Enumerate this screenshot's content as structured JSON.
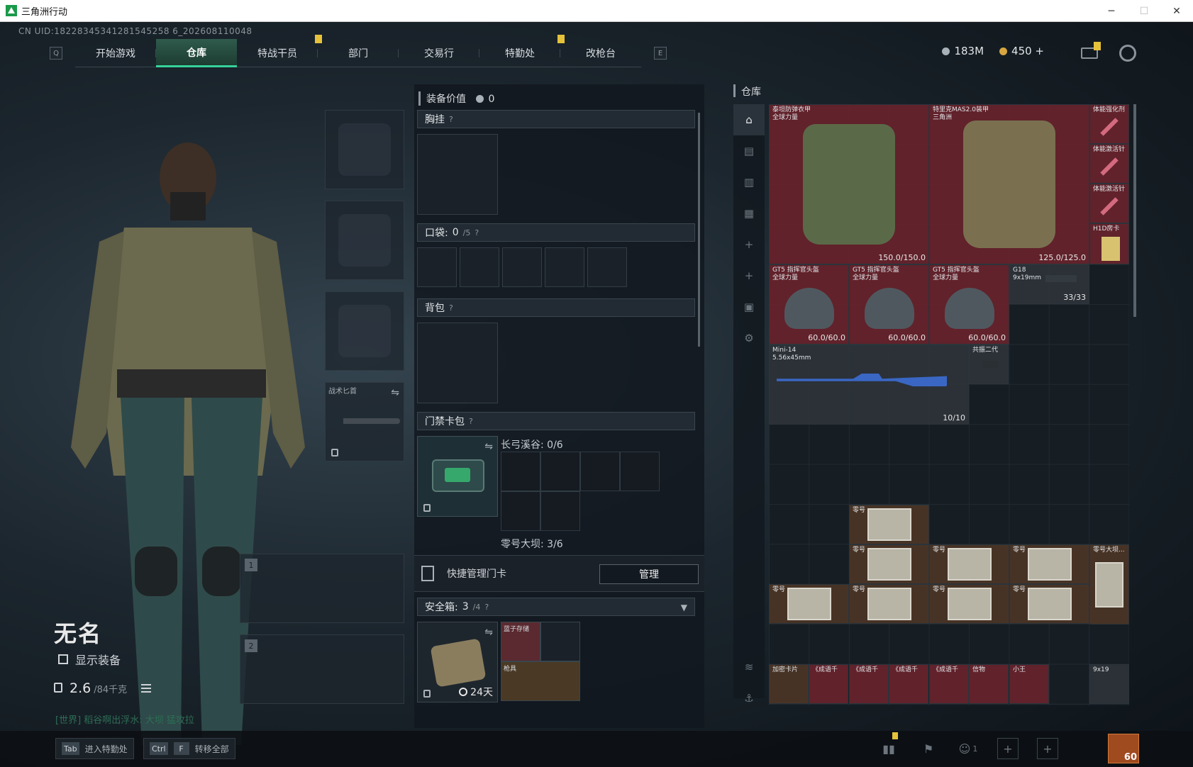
{
  "window": {
    "title": "三角洲行动",
    "minimize": "─",
    "maximize": "☐",
    "close": "✕"
  },
  "uid": "CN UID:18228345341281545258 6_202608110048",
  "nav": {
    "left_key": "Q",
    "right_key": "E",
    "tabs": [
      {
        "label": "开始游戏",
        "active": false
      },
      {
        "label": "仓库",
        "active": true
      },
      {
        "label": "特战干员",
        "active": false
      },
      {
        "label": "部门",
        "active": false
      },
      {
        "label": "交易行",
        "active": false
      },
      {
        "label": "特勤处",
        "active": false
      },
      {
        "label": "改枪台",
        "active": false
      }
    ]
  },
  "currency": {
    "silver": "183M",
    "gold": "450 +"
  },
  "character": {
    "name": "无名",
    "show_equipment": "显示装备",
    "weight": "2.6",
    "weight_max": "/84千克",
    "world_chat": "[世界] 稻谷啊出浮水: 大坝 猛攻拉"
  },
  "gear_slots": {
    "melee_label": "战术匕首",
    "weapon1": "1",
    "weapon2": "2"
  },
  "equipment": {
    "value_label": "装备价值",
    "value": "0",
    "chest_rig": "胸挂",
    "pocket": "口袋:",
    "pocket_count": "0",
    "pocket_max": "/5",
    "backpack": "背包",
    "access_card": "门禁卡包",
    "map1": "长弓溪谷: 0/6",
    "map2": "零号大坝: 3/6",
    "quick_manage": "快捷管理门卡",
    "manage": "管理",
    "safebox": "安全箱:",
    "safebox_count": "3",
    "safebox_max": "/4",
    "safebox_timer": "24天",
    "safebox_items": [
      "蓝子存储",
      "枪具"
    ],
    "help": "?"
  },
  "warehouse": {
    "title": "仓库",
    "items": {
      "armor1_name": "泰坦防弹衣甲\n全球力量",
      "armor1_dur": "150.0/150.0",
      "armor2_name": "特里克MAS2.0装甲\n三角洲",
      "armor2_dur": "125.0/125.0",
      "syringe1": "体能强化剂",
      "syringe2": "体能激活针",
      "syringe3": "体能激活针",
      "card": "H1D房卡",
      "helmet_name": "GT5 指挥官头盔\n全球力量",
      "helmet_dur": "60.0/60.0",
      "pistol_name": "G18\n9x19mm",
      "pistol_ammo": "33/33",
      "rifle_name": "Mini-14\n5.56x45mm",
      "rifle_ammo": "10/10",
      "scope_name": "共振二代",
      "map_name": "零号",
      "map_big": "零号大坝...",
      "bottom": [
        "加密卡片",
        "《成语千",
        "《成语千",
        "《成语千",
        "《成语千",
        "信物",
        "小王",
        "9x19"
      ]
    }
  },
  "bottom_bar": {
    "tab_key": "Tab",
    "tab_label": "进入特勤处",
    "ctrl_key": "Ctrl",
    "f_key": "F",
    "ctrl_label": "转移全部",
    "squad_count": "1",
    "player_level": "60"
  },
  "colors": {
    "accent": "#35d39a",
    "alert": "#e6c23a",
    "rarity_red": "#6e232d"
  }
}
